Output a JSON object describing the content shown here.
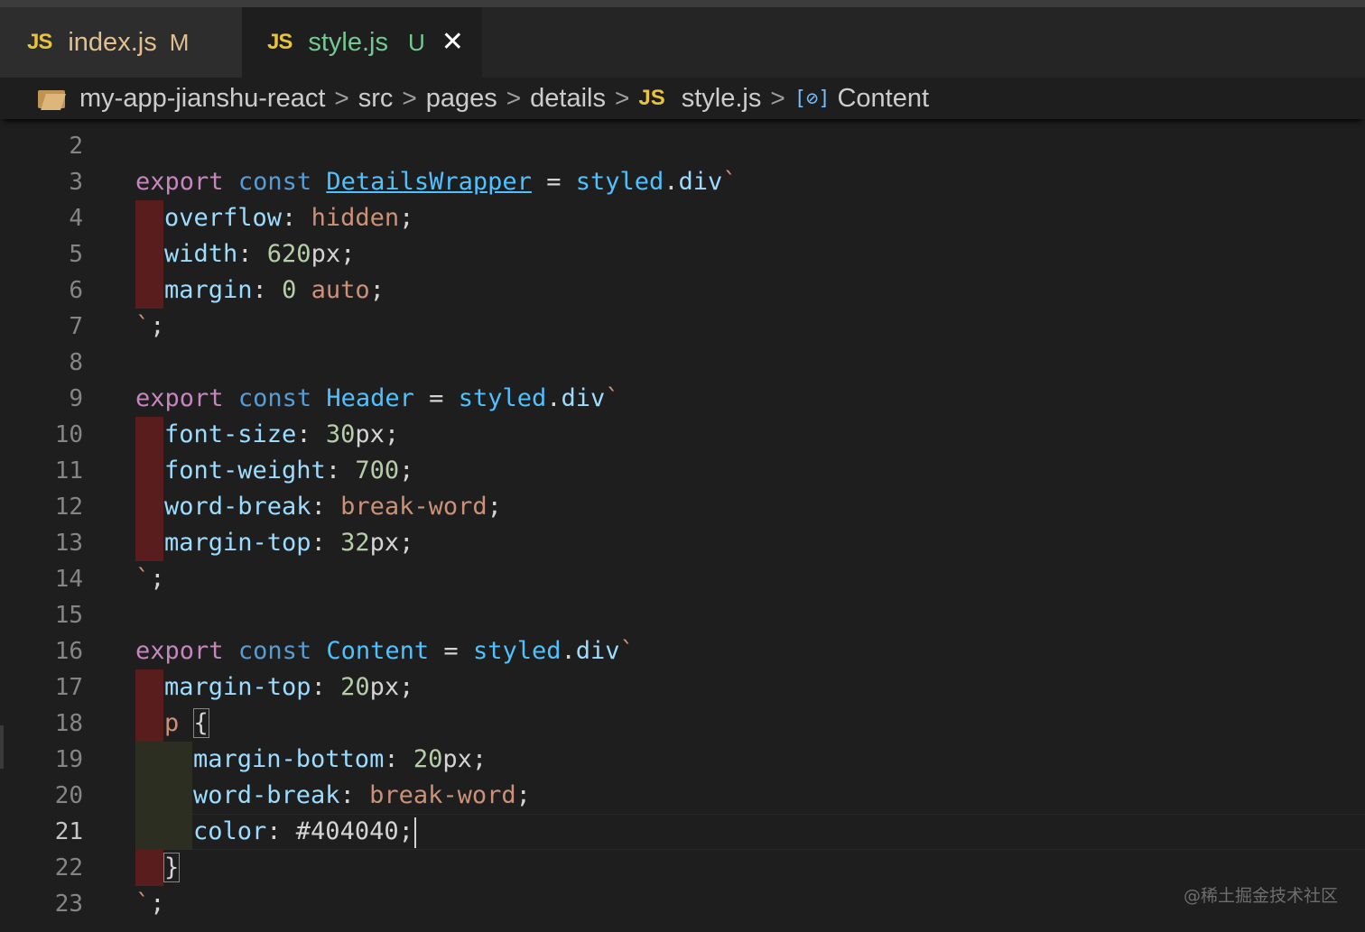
{
  "tabs": [
    {
      "badge": "JS",
      "label": "index.js",
      "status": "M"
    },
    {
      "badge": "JS",
      "label": "style.js",
      "status": "U",
      "close_glyph": "✕"
    }
  ],
  "breadcrumb": {
    "folder_icon": "folder-icon",
    "items": [
      "my-app-jianshu-react",
      "src",
      "pages",
      "details"
    ],
    "file_badge": "JS",
    "file": "style.js",
    "symbol_icon": "[⊘]",
    "symbol": "Content",
    "separator": ">"
  },
  "editor": {
    "current_line": 21,
    "lines": [
      {
        "n": "2"
      },
      {
        "n": "3"
      },
      {
        "n": "4"
      },
      {
        "n": "5"
      },
      {
        "n": "6"
      },
      {
        "n": "7"
      },
      {
        "n": "8"
      },
      {
        "n": "9"
      },
      {
        "n": "10"
      },
      {
        "n": "11"
      },
      {
        "n": "12"
      },
      {
        "n": "13"
      },
      {
        "n": "14"
      },
      {
        "n": "15"
      },
      {
        "n": "16"
      },
      {
        "n": "17"
      },
      {
        "n": "18"
      },
      {
        "n": "19"
      },
      {
        "n": "20"
      },
      {
        "n": "21"
      },
      {
        "n": "22"
      },
      {
        "n": "23"
      }
    ],
    "tokens": {
      "export": "export",
      "const": "const",
      "eq": " = ",
      "styled": "styled",
      "dot": ".",
      "div": "div",
      "backtick": "`",
      "semi": ";",
      "end": "`;",
      "DetailsWrapper": "DetailsWrapper",
      "Header": "Header",
      "Content": "Content",
      "overflow": "overflow",
      "hidden": "hidden",
      "width": "width",
      "v620": "620",
      "px": "px",
      "margin": "margin",
      "zero": "0",
      "auto": "auto",
      "font_size": "font-size",
      "v30": "30",
      "font_weight": "font-weight",
      "v700": "700",
      "word_break": "word-break",
      "break_word": "break-word",
      "margin_top": "margin-top",
      "v32": "32",
      "v20": "20",
      "p": "p",
      "lbrace": "{",
      "rbrace": "}",
      "margin_bottom": "margin-bottom",
      "color": "color",
      "color_val": "#404040",
      "colon": ": "
    }
  },
  "watermark": "@稀土掘金技术社区"
}
